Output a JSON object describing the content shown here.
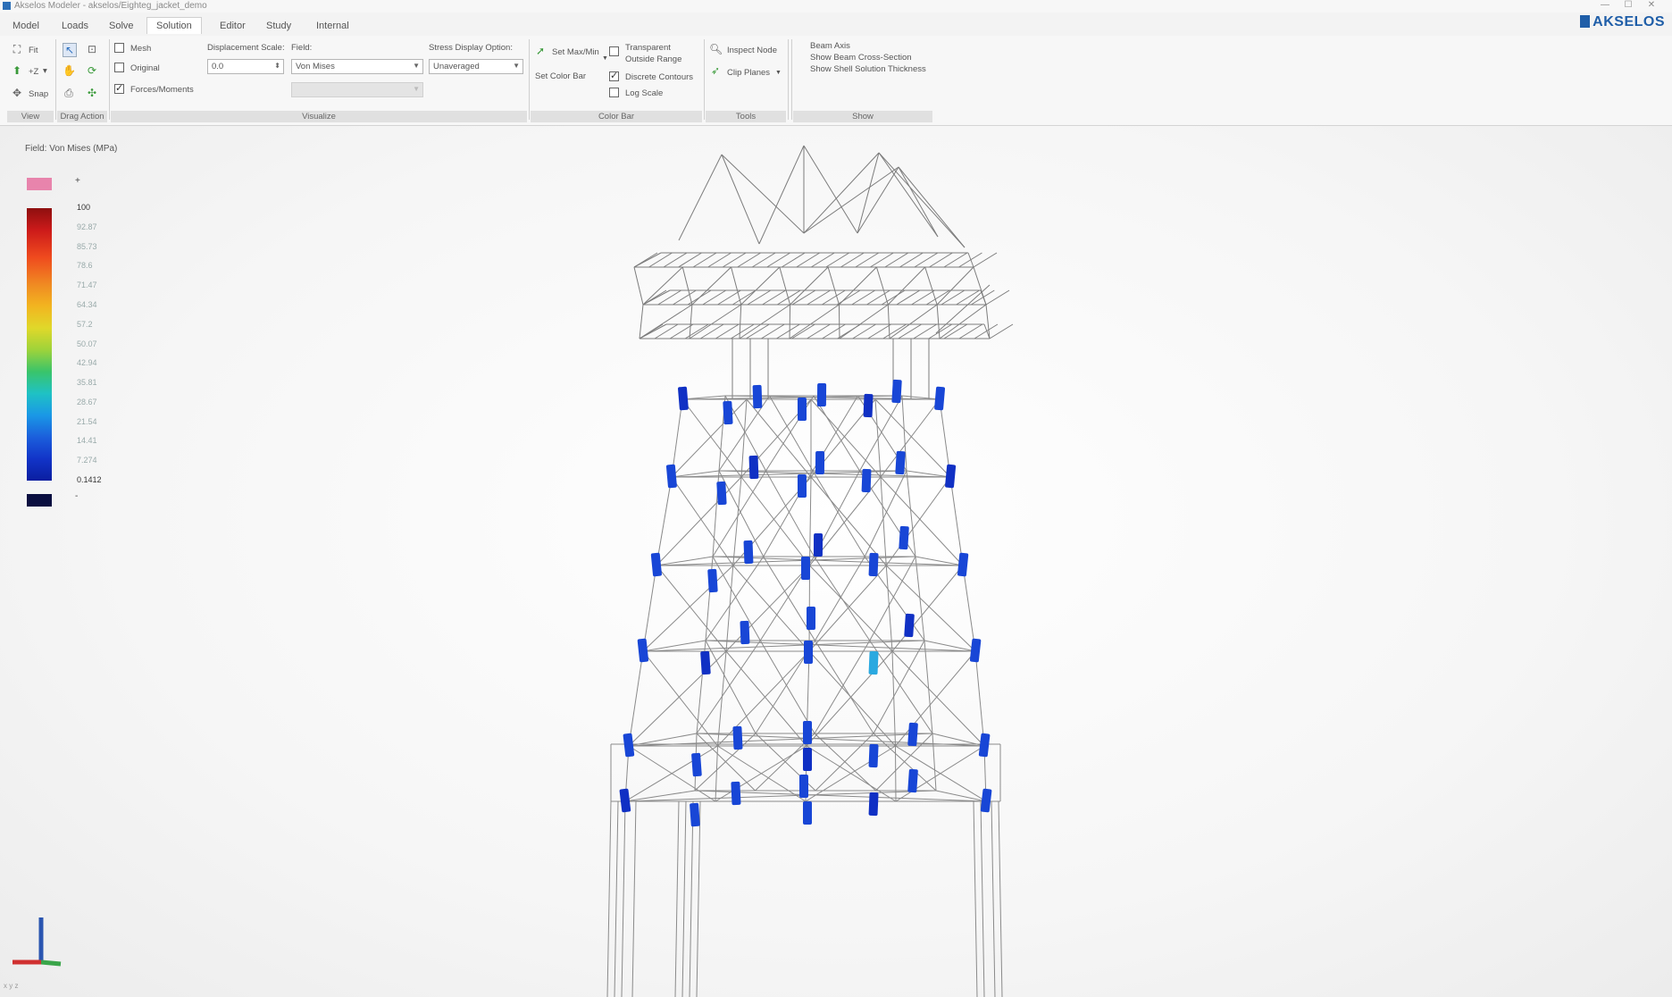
{
  "window": {
    "title": "Akselos Modeler - akselos/Eighteg_jacket_demo"
  },
  "logo": {
    "text": "AKSELOS"
  },
  "menu": {
    "tabs": [
      "Model",
      "Loads",
      "Solve",
      "Solution",
      "Editor",
      "Study",
      "Internal"
    ],
    "active": "Solution"
  },
  "ribbon": {
    "view": {
      "fit": "Fit",
      "z": "+Z",
      "snap": "Snap",
      "caption": "View"
    },
    "drag": {
      "caption": "Drag Action"
    },
    "visualize": {
      "mesh": "Mesh",
      "original": "Original",
      "forces": "Forces/Moments",
      "disp_label": "Displacement Scale:",
      "disp_value": "0.0",
      "field_label": "Field:",
      "field_value": "Von Mises",
      "stress_label": "Stress Display Option:",
      "stress_value": "Unaveraged",
      "caption": "Visualize",
      "mesh_checked": false,
      "original_checked": false,
      "forces_checked": true
    },
    "colorbar": {
      "set_max_min": "Set Max/Min",
      "set_color_bar": "Set Color Bar",
      "transparent": "Transparent",
      "outside_range": "Outside Range",
      "discrete": "Discrete Contours",
      "log_scale": "Log Scale",
      "caption": "Color Bar",
      "transparent_checked": false,
      "discrete_checked": true,
      "log_checked": false
    },
    "tools": {
      "inspect": "Inspect Node",
      "clip": "Clip Planes",
      "caption": "Tools"
    },
    "show": {
      "beam_axis": "Beam Axis",
      "beam_cross": "Show Beam Cross-Section",
      "shell": "Show Shell Solution Thickness",
      "caption": "Show"
    }
  },
  "legend": {
    "field_label": "Field: Von Mises (MPa)",
    "top_marker": "+",
    "bottom_marker": "-",
    "ticks": [
      "100",
      "92.87",
      "85.73",
      "78.6",
      "71.47",
      "64.34",
      "57.2",
      "50.07",
      "42.94",
      "35.81",
      "28.67",
      "21.54",
      "14.41",
      "7.274",
      "0.1412"
    ]
  },
  "viewport": {
    "coords": "x y z"
  }
}
